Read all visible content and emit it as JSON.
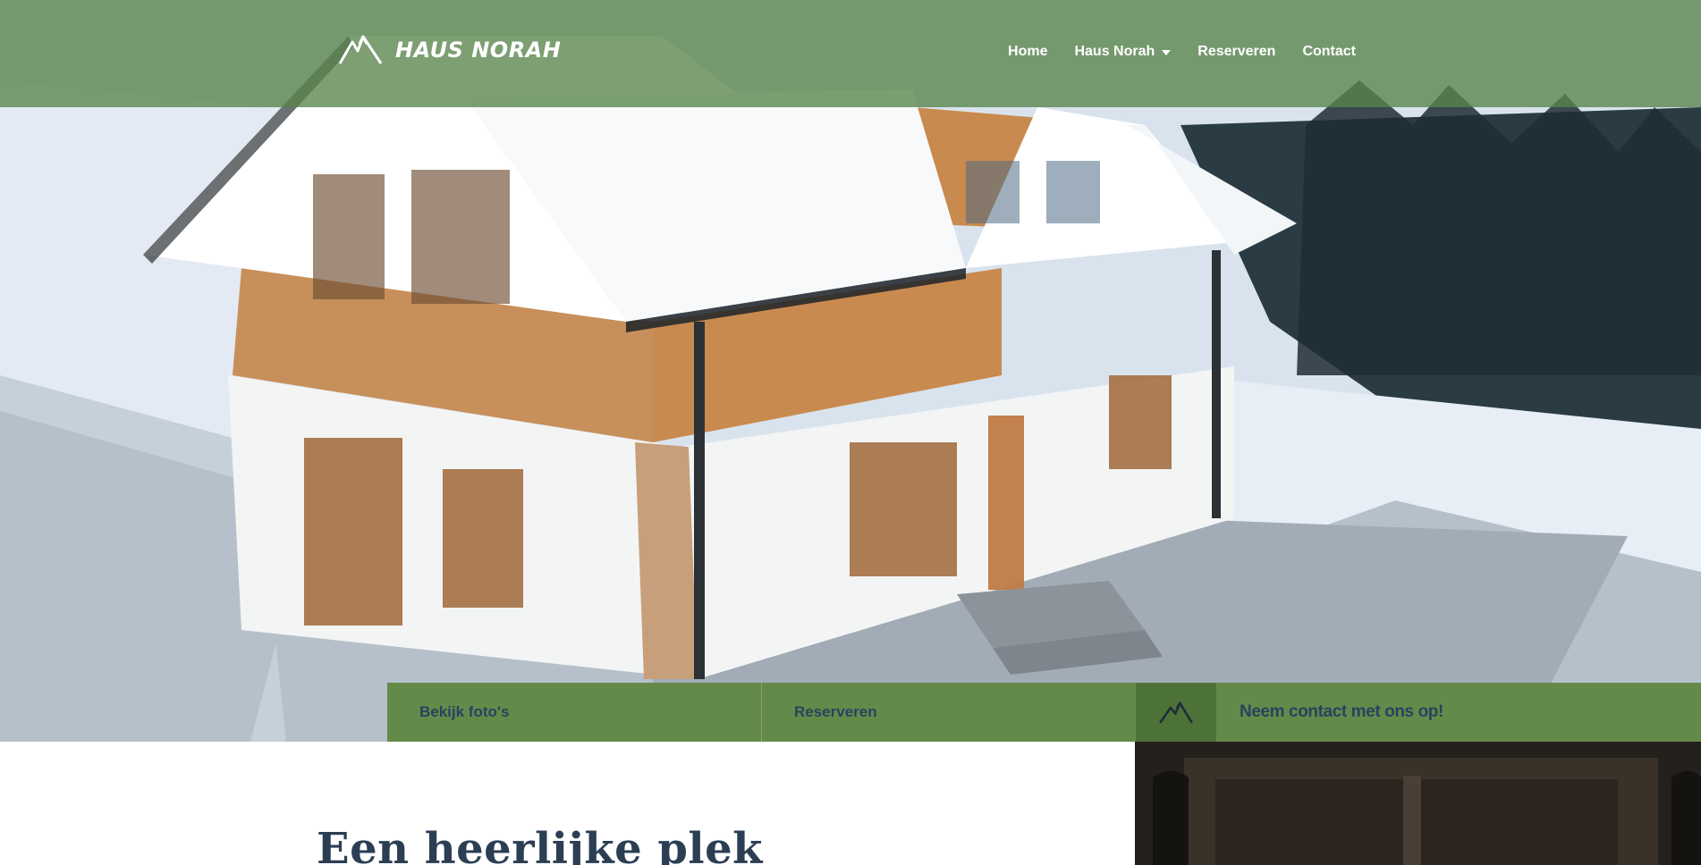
{
  "header": {
    "brand": "HAUS NORAH",
    "nav": [
      {
        "label": "Home",
        "active": true,
        "has_dropdown": false
      },
      {
        "label": "Haus Norah",
        "active": false,
        "has_dropdown": true
      },
      {
        "label": "Reserveren",
        "active": false,
        "has_dropdown": false
      },
      {
        "label": "Contact",
        "active": false,
        "has_dropdown": false
      }
    ]
  },
  "hero": {
    "actions": {
      "photos": "Bekijk foto's",
      "reserve": "Reserveren",
      "contact": "Neem contact met ons op!"
    }
  },
  "main": {
    "headline": "Een heerlijke plek"
  },
  "theme": {
    "header_bg": "#58844a",
    "action_bg": "#648a4a",
    "action_icon_bg": "#4d7238",
    "action_text": "#28435f",
    "headline_text": "#2b3e54"
  },
  "icons": {
    "logo": "mountain-icon",
    "contact": "mountain-icon",
    "dropdown": "caret-down-icon"
  }
}
